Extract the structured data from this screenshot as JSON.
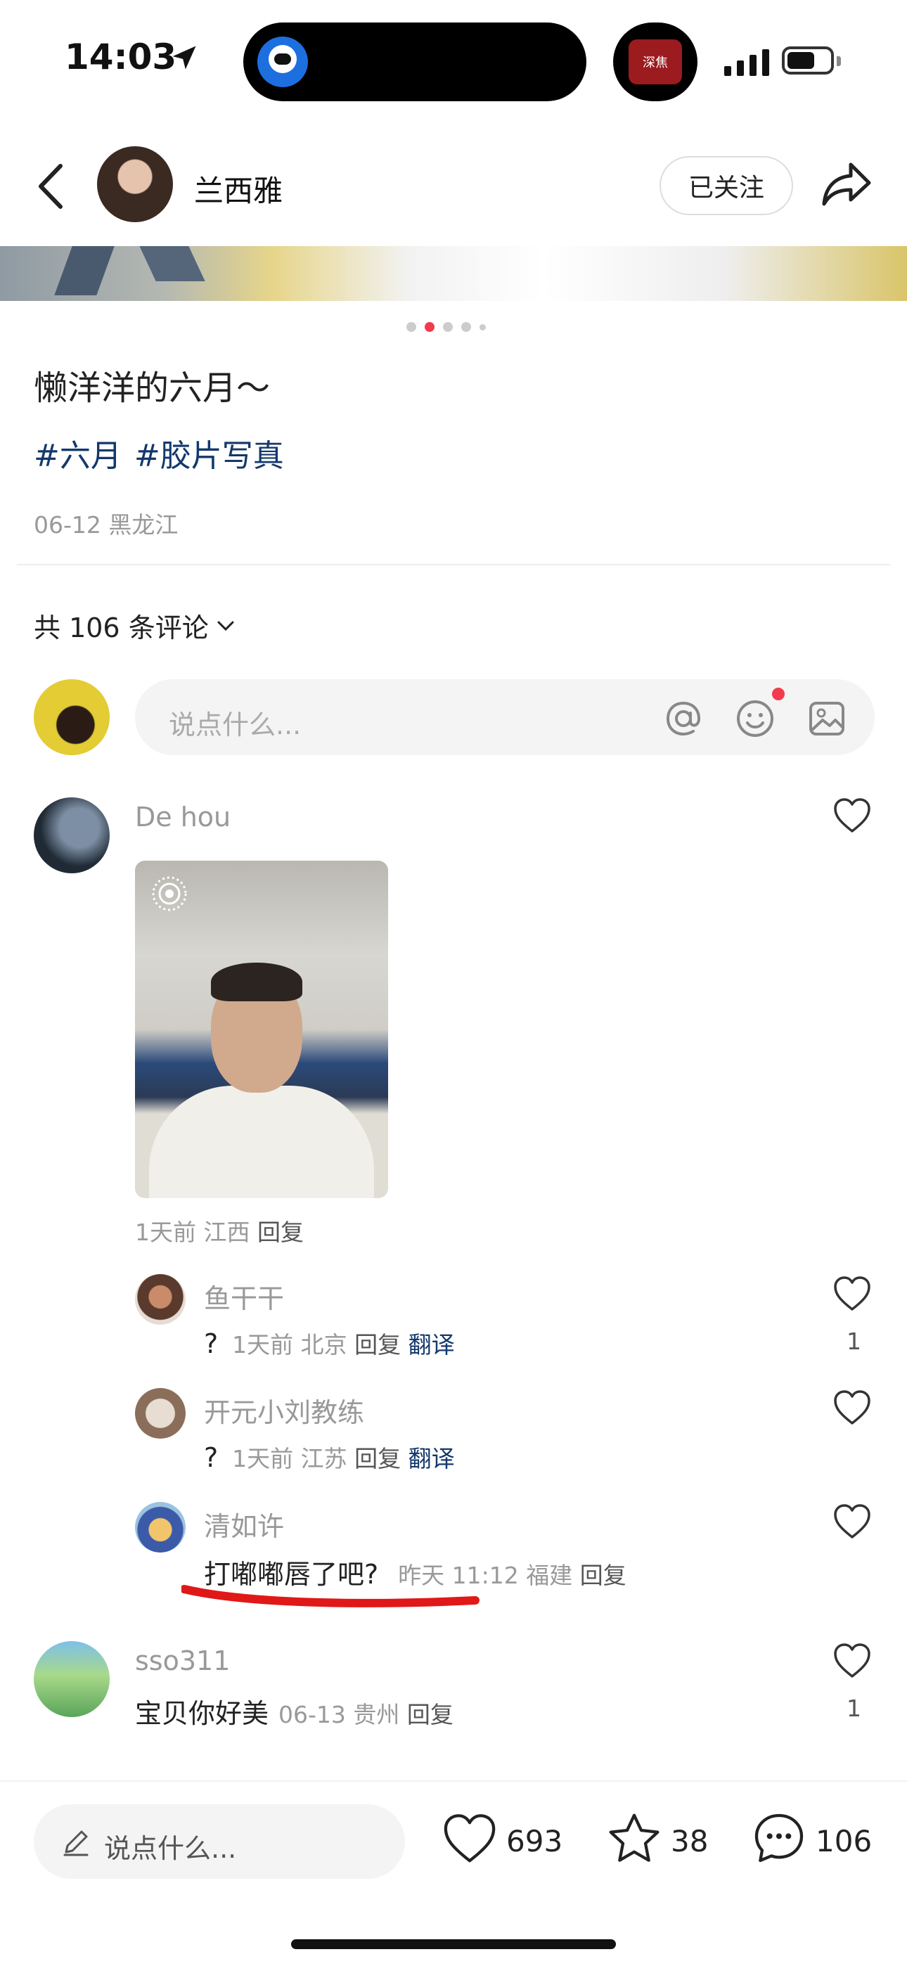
{
  "status_bar": {
    "time": "14:03",
    "app_badge": "深焦"
  },
  "header": {
    "host_name": "兰西雅",
    "follow_label": "已关注"
  },
  "gallery": {
    "total": 5,
    "active": 2
  },
  "post": {
    "title": "懒洋洋的六月～",
    "tags": [
      "#六月",
      "#胶片写真"
    ],
    "meta": "06-12 黑龙江"
  },
  "comments_header": {
    "label": "共 106 条评论"
  },
  "comment_input": {
    "placeholder": "说点什么..."
  },
  "comments": [
    {
      "name": "De hou",
      "has_image": true,
      "meta": "1天前 江西",
      "reply": "回复",
      "replies": [
        {
          "name": "鱼干干",
          "text": "?",
          "meta": "1天前 北京",
          "reply": "回复",
          "translate": "翻译",
          "likes": "1"
        },
        {
          "name": "开元小刘教练",
          "text": "?",
          "meta": "1天前 江苏",
          "reply": "回复",
          "translate": "翻译",
          "likes": ""
        },
        {
          "name": "清如许",
          "text": "打嘟嘟唇了吧?",
          "meta": "昨天 11:12 福建",
          "reply": "回复",
          "likes": ""
        }
      ]
    },
    {
      "name": "sso311",
      "text": "宝贝你好美",
      "meta": "06-13 贵州",
      "reply": "回复",
      "likes": "1"
    }
  ],
  "bottom_bar": {
    "placeholder": "说点什么...",
    "likes": "693",
    "stars": "38",
    "comments": "106"
  },
  "colors": {
    "accent_red": "#f33b4e",
    "tag_blue": "#13386c"
  }
}
